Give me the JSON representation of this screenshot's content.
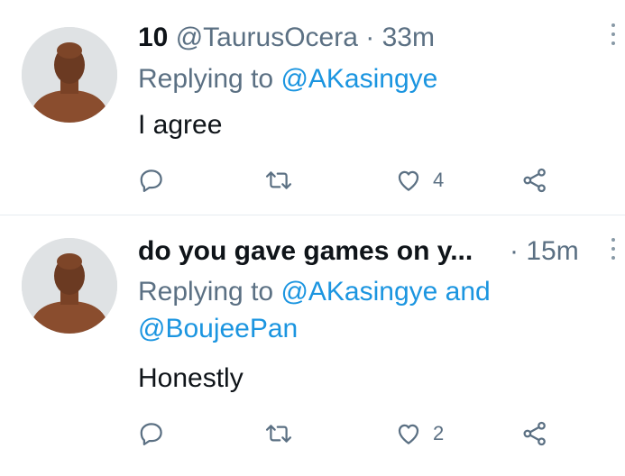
{
  "colors": {
    "accent": "#1b95e0",
    "secondary_text": "#5b7083",
    "primary_text": "#0f1419",
    "divider": "#e6ecf0"
  },
  "tweets": [
    {
      "display_name": "10",
      "handle": "@TaurusOcera",
      "separator": "·",
      "time": "33m",
      "replying_prefix": "Replying to",
      "mention_1": "@AKasingye",
      "text": "I agree",
      "like_count": "4",
      "icons": [
        "reply-icon",
        "retweet-icon",
        "like-icon",
        "share-icon",
        "more-icon"
      ]
    },
    {
      "display_name": "do you gave games on y...",
      "separator": "·",
      "time": "15m",
      "replying_prefix": "Replying to",
      "mention_1": "@AKasingye",
      "conjunction": "and",
      "mention_2": "@BoujeePan",
      "text": "Honestly",
      "like_count": "2",
      "icons": [
        "reply-icon",
        "retweet-icon",
        "like-icon",
        "share-icon",
        "more-icon"
      ]
    }
  ]
}
